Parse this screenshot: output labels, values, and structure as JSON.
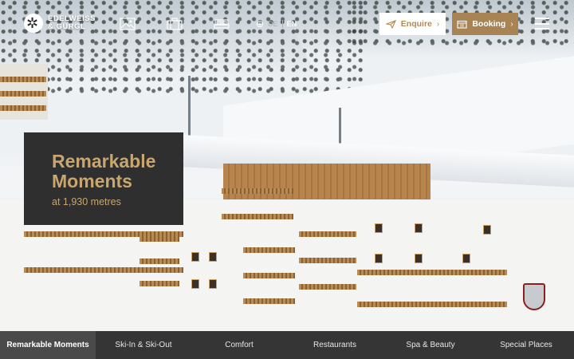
{
  "brand": {
    "line1": "EDELWEISS",
    "line2": "& GURGL"
  },
  "header_icons": [
    "gallery-icon",
    "suitcase-icon",
    "bed-icon"
  ],
  "languages": {
    "inactive": "DE",
    "active": "EN"
  },
  "buttons": {
    "enquire": "Enquire",
    "booking": "Booking"
  },
  "hero": {
    "title_line1": "Remarkable",
    "title_line2": "Moments",
    "subtitle": "at 1,930 metres"
  },
  "nav": [
    {
      "label": "Remarkable Moments",
      "active": true
    },
    {
      "label": "Ski-In & Ski-Out",
      "active": false
    },
    {
      "label": "Comfort",
      "active": false
    },
    {
      "label": "Restaurants",
      "active": false
    },
    {
      "label": "Spa & Beauty",
      "active": false
    },
    {
      "label": "Special Places",
      "active": false
    }
  ],
  "colors": {
    "accent": "#a88353",
    "card_bg": "#2f2f2f",
    "nav_bg": "#353535"
  }
}
